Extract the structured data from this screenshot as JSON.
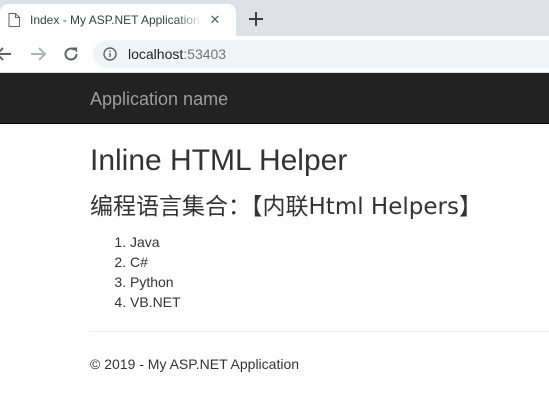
{
  "browser": {
    "tab_title": "Index - My ASP.NET Application",
    "tab_close_glyph": "✕",
    "url_host": "localhost",
    "url_port": ":53403",
    "icons": [
      "page-icon",
      "close-icon",
      "plus-icon",
      "back-icon",
      "forward-icon",
      "reload-icon",
      "info-icon"
    ]
  },
  "navbar": {
    "brand": "Application name",
    "background": "#222222",
    "brand_color": "#9d9d9d"
  },
  "main": {
    "title": "Inline HTML Helper",
    "subtitle": "编程语言集合：【内联Html Helpers】",
    "languages": [
      "Java",
      "C#",
      "Python",
      "VB.NET"
    ]
  },
  "footer": {
    "text": "© 2019 - My ASP.NET Application"
  }
}
